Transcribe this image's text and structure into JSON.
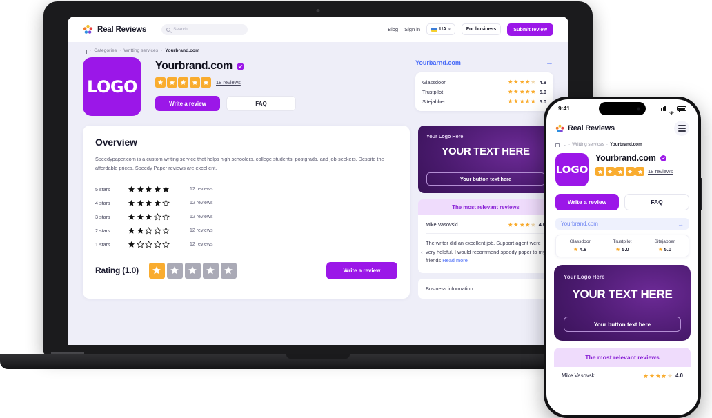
{
  "site": {
    "brand_name": "Real Reviews",
    "logo_icon": "pinwheel-star-icon",
    "search_placeholder": "Search",
    "search_icon": "search-icon",
    "nav": {
      "blog": "Blog",
      "sign_in": "Sign in",
      "language": "UA",
      "language_caret": "▾",
      "flag_icon": "ukraine-flag-icon",
      "for_business": "For business",
      "submit_review": "Submit review"
    },
    "breadcrumb": {
      "home_icon": "home-icon",
      "items": [
        "Categories",
        "Writting services",
        "Yourbrand.com"
      ],
      "separator": "·"
    }
  },
  "hero": {
    "logo_text": "LOGO",
    "brand_title": "Yourbrand.com",
    "verified_icon": "verified-check-icon",
    "stars_filled": 5,
    "stars_total": 5,
    "reviews_link": "18 reviews",
    "write_review": "Write a review",
    "faq": "FAQ",
    "site_link": "Yourbarnd.com",
    "arrow_icon": "arrow-right-icon",
    "sources": [
      {
        "name": "Glassdoor",
        "stars": 4.5,
        "value": "4.8"
      },
      {
        "name": "Trustpilot",
        "stars": 5,
        "value": "5.0"
      },
      {
        "name": "Sitejabber",
        "stars": 5,
        "value": "5.0"
      }
    ]
  },
  "overview": {
    "title": "Overview",
    "text": "Speedypaper.com is a custom writing service that helps high schoolers, college students, postgrads, and job-seekers. Despite the affordable prices, Speedy Paper reviews are excellent.",
    "breakdown": [
      {
        "label": "5 stars",
        "filled": 5,
        "count": "12 reviews"
      },
      {
        "label": "4 stars",
        "filled": 4,
        "count": "12 reviews"
      },
      {
        "label": "3 stars",
        "filled": 3,
        "count": "12 reviews"
      },
      {
        "label": "2 stars",
        "filled": 2,
        "count": "12 reviews"
      },
      {
        "label": "1 stars",
        "filled": 1,
        "count": "12 reviews"
      }
    ],
    "rating_label": "Rating (1.0)",
    "rating_filled": 1,
    "rating_total": 5,
    "write_review": "Write a review"
  },
  "promo": {
    "logo_text": "Your Logo Here",
    "headline": "YOUR TEXT HERE",
    "button": "Your button text here",
    "bg_color": "#4a1a6e"
  },
  "relevant": {
    "heading": "The most relevant reviews",
    "reviewer": "Mike Vasovski",
    "rating_value": "4.0",
    "rating_stars": 4.5,
    "text": "The writer did an excellent job. Support agent were very helpful. I would recommend speedy paper to my friends",
    "read_more": "Read more",
    "prev_icon": "chevron-left-icon",
    "next_icon": "chevron-right-icon",
    "business_info": "Business information:"
  },
  "phone": {
    "status_time": "9:41",
    "signal_icon": "cellular-signal-icon",
    "wifi_icon": "wifi-icon",
    "battery_icon": "battery-icon",
    "menu_icon": "hamburger-menu-icon",
    "breadcrumb": [
      "· ..",
      "Writting services",
      "Yourbrand.com"
    ],
    "site_link": "Yourbrand.com",
    "arrow_icon": "arrow-right-icon",
    "sources": [
      {
        "name": "Glassdoor",
        "value": "4.8"
      },
      {
        "name": "Trustpilot",
        "value": "5.0"
      },
      {
        "name": "Sitejabber",
        "value": "5.0"
      }
    ]
  },
  "colors": {
    "accent_purple": "#9b17e8",
    "star_gold": "#f9ac2f",
    "link_blue": "#4a6cf7",
    "page_bg": "#eeeef8",
    "promo_pink": "#efdcfc"
  }
}
